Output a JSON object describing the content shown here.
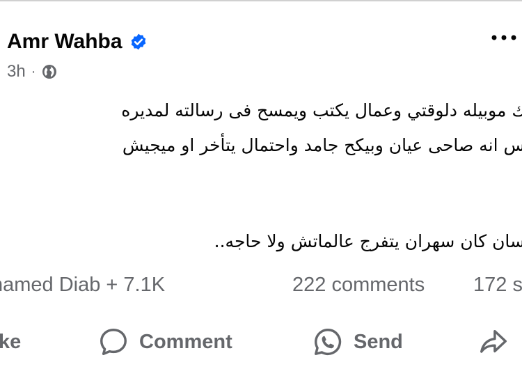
{
  "post": {
    "author": "Amr Wahba",
    "time": "3h",
    "dot": "·",
    "lines": [
      "ك موبيله دلوقتي وعمال يكتب ويمسح فى رسالته لمديره",
      "س انه صاحى عيان وبيكح جامد واحتمال يتأخر او ميجيش",
      "سان كان سهران يتفرج عالماتش ولا حاجه.."
    ]
  },
  "stats": {
    "reactions": "hamed Diab + 7.1K",
    "comments": "222 comments",
    "shares": "172 s"
  },
  "actions": {
    "like": "ike",
    "comment": "Comment",
    "send": "Send"
  },
  "colors": {
    "text": "#050505",
    "secondary": "#65676b",
    "verified": "#0866ff"
  },
  "icons": [
    "verified-badge-icon",
    "globe-icon",
    "more-options-icon",
    "comment-icon",
    "whatsapp-icon",
    "share-icon"
  ]
}
